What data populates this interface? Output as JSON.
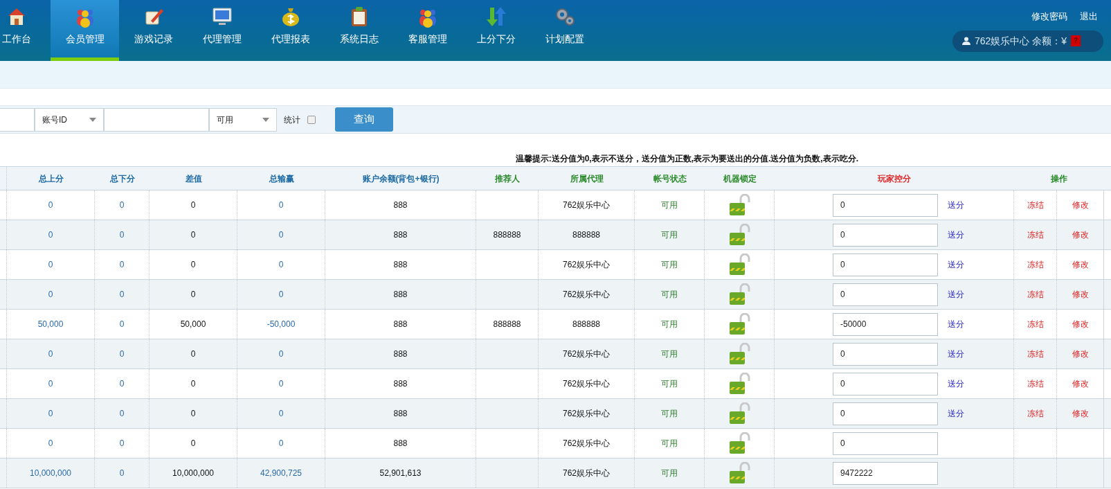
{
  "nav": [
    {
      "label": "工作台",
      "selected": false
    },
    {
      "label": "会员管理",
      "selected": true
    },
    {
      "label": "游戏记录",
      "selected": false
    },
    {
      "label": "代理管理",
      "selected": false
    },
    {
      "label": "代理报表",
      "selected": false
    },
    {
      "label": "系统日志",
      "selected": false
    },
    {
      "label": "客服管理",
      "selected": false
    },
    {
      "label": "上分下分",
      "selected": false
    },
    {
      "label": "计划配置",
      "selected": false
    }
  ],
  "top_links": [
    "修改密码",
    "退出"
  ],
  "account": {
    "name": "762娱乐中心 余额：¥",
    "balance": "?"
  },
  "filter": {
    "field_select": "账号ID",
    "status_select": "可用",
    "stat_label": "统计",
    "stat_checked": false,
    "search_button": "查询"
  },
  "tip": "温馨提示:送分值为0,表示不送分，送分值为正数,表示为要送出的分值.送分值为负数,表示吃分.",
  "columns": [
    {
      "label": "总上分",
      "color": "#1e6aa5"
    },
    {
      "label": "总下分",
      "color": "#1e6aa5"
    },
    {
      "label": "差值",
      "color": "#1e6aa5"
    },
    {
      "label": "总输赢",
      "color": "#1e6aa5"
    },
    {
      "label": "账户余额(背包+银行)",
      "color": "#1e6aa5"
    },
    {
      "label": "推荐人",
      "color": "#2a8a2a"
    },
    {
      "label": "所属代理",
      "color": "#2a8a2a"
    },
    {
      "label": "帐号状态",
      "color": "#2a8a2a"
    },
    {
      "label": "机器锁定",
      "color": "#2a8a2a"
    },
    {
      "label": "玩家控分",
      "color": "#e02a2a"
    },
    {
      "label": "操作",
      "color": "#2a8a2a"
    }
  ],
  "rows": [
    {
      "total_up": "0",
      "total_down": "0",
      "diff": "0",
      "total_win": "0",
      "balance": "888",
      "agent": "762娱乐中心",
      "status": "可用",
      "control": "0",
      "send": "送分",
      "freeze": "冻结",
      "edit": "修改"
    },
    {
      "total_up": "0",
      "total_down": "0",
      "diff": "0",
      "total_win": "0",
      "balance": "888",
      "referrer": "888888",
      "agent": "888888",
      "status": "可用",
      "control": "0",
      "send": "送分",
      "freeze": "冻结",
      "edit": "修改"
    },
    {
      "total_up": "0",
      "total_down": "0",
      "diff": "0",
      "total_win": "0",
      "balance": "888",
      "agent": "762娱乐中心",
      "status": "可用",
      "control": "0",
      "send": "送分",
      "freeze": "冻结",
      "edit": "修改"
    },
    {
      "total_up": "0",
      "total_down": "0",
      "diff": "0",
      "total_win": "0",
      "balance": "888",
      "agent": "762娱乐中心",
      "status": "可用",
      "control": "0",
      "send": "送分",
      "freeze": "冻结",
      "edit": "修改"
    },
    {
      "total_up": "50,000",
      "total_down": "0",
      "diff": "50,000",
      "total_win": "-50,000",
      "balance": "888",
      "referrer": "888888",
      "agent": "888888",
      "status": "可用",
      "control": "-50000",
      "send": "送分",
      "freeze": "冻结",
      "edit": "修改"
    },
    {
      "total_up": "0",
      "total_down": "0",
      "diff": "0",
      "total_win": "0",
      "balance": "888",
      "agent": "762娱乐中心",
      "status": "可用",
      "control": "0",
      "send": "送分",
      "freeze": "冻结",
      "edit": "修改"
    },
    {
      "total_up": "0",
      "total_down": "0",
      "diff": "0",
      "total_win": "0",
      "balance": "888",
      "agent": "762娱乐中心",
      "status": "可用",
      "control": "0",
      "send": "送分",
      "freeze": "冻结",
      "edit": "修改"
    },
    {
      "total_up": "0",
      "total_down": "0",
      "diff": "0",
      "total_win": "0",
      "balance": "888",
      "agent": "762娱乐中心",
      "status": "可用",
      "control": "0",
      "send": "送分",
      "freeze": "冻结",
      "edit": "修改"
    },
    {
      "total_up": "0",
      "total_down": "0",
      "diff": "0",
      "total_win": "0",
      "balance": "888",
      "agent": "762娱乐中心",
      "status": "可用",
      "control": "0"
    },
    {
      "total_up": "10,000,000",
      "total_down": "0",
      "diff": "10,000,000",
      "total_win": "42,900,725",
      "balance": "52,901,613",
      "agent": "762娱乐中心",
      "status": "可用",
      "control": "9472222"
    }
  ]
}
